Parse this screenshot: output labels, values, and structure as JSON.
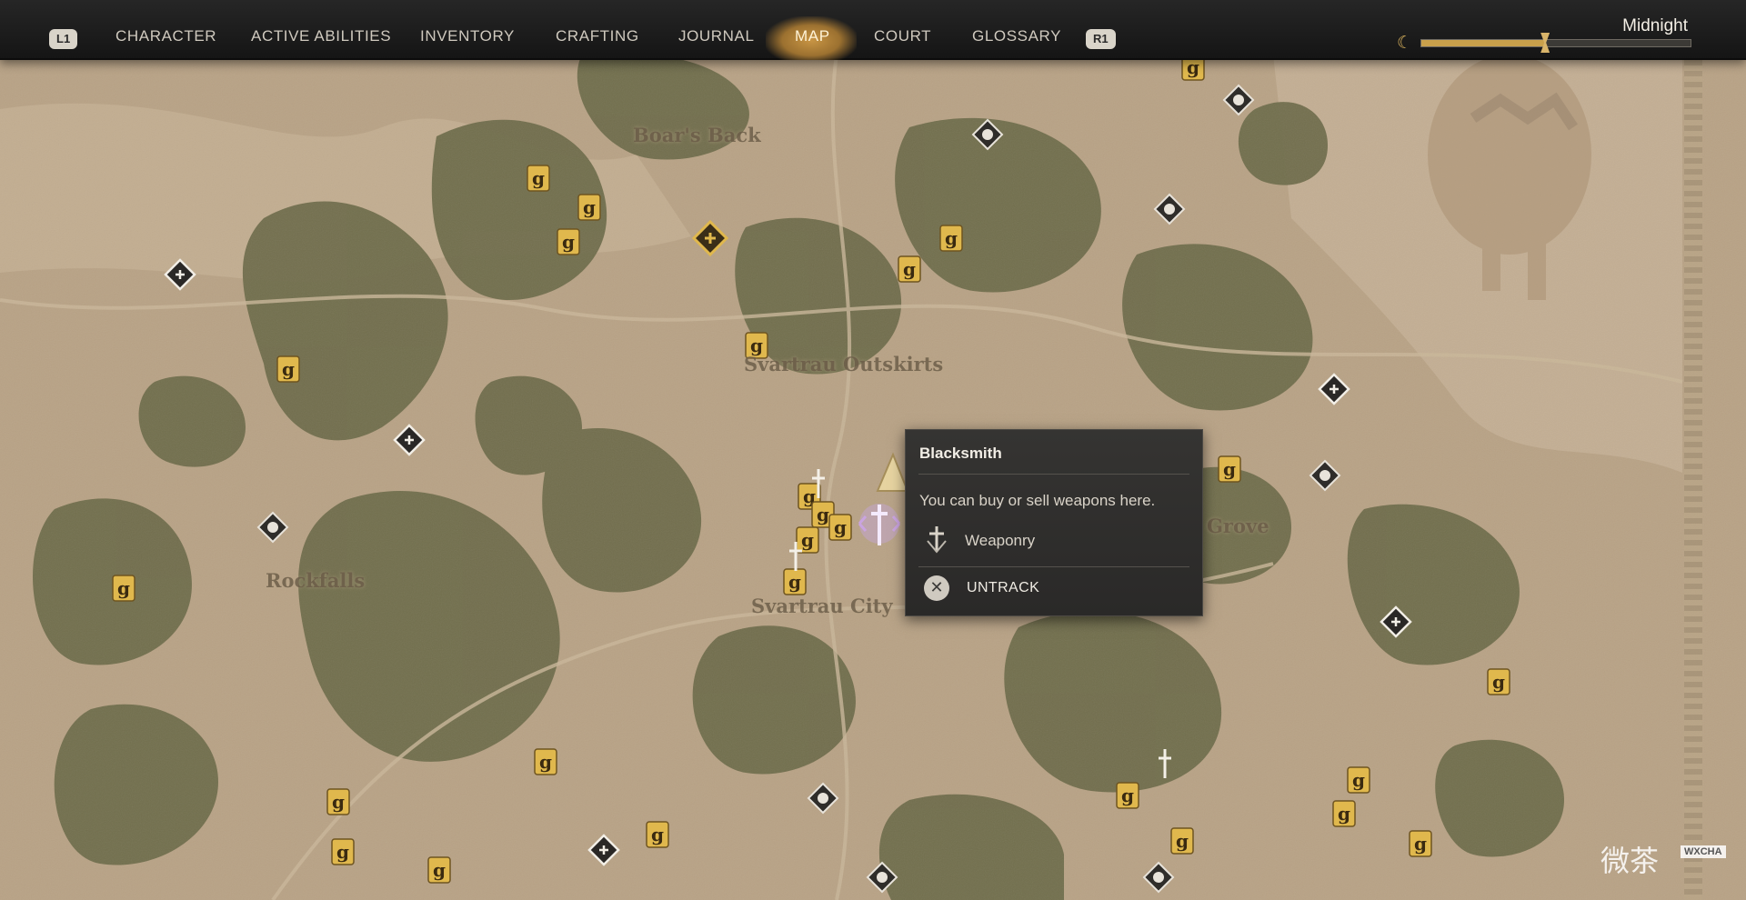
{
  "nav": {
    "left_hint": "L1",
    "right_hint": "R1",
    "tabs": [
      {
        "label": "CHARACTER",
        "active": false
      },
      {
        "label": "ACTIVE ABILITIES",
        "active": false
      },
      {
        "label": "INVENTORY",
        "active": false
      },
      {
        "label": "CRAFTING",
        "active": false
      },
      {
        "label": "JOURNAL",
        "active": false
      },
      {
        "label": "MAP",
        "active": true
      },
      {
        "label": "COURT",
        "active": false
      },
      {
        "label": "GLOSSARY",
        "active": false
      }
    ]
  },
  "time": {
    "label": "Midnight",
    "icon": "crescent-moon-icon",
    "progress": 0.46
  },
  "map": {
    "places": [
      {
        "name": "Boar's Back",
        "icon": "trident-icon"
      },
      {
        "name": "Svartrau Outskirts"
      },
      {
        "name": "Rockfalls",
        "icon": "trident-icon"
      },
      {
        "name": "Svartrau City"
      },
      {
        "name": "Grove"
      }
    ],
    "icon_legend": {
      "gold": "gold-rune-marker-icon",
      "diamond": "diamond-waypoint-icon",
      "sword": "sword-marker-icon",
      "highlight": "gold-diamond-marker-icon"
    }
  },
  "popup": {
    "title": "Blacksmith",
    "description": "You can buy or sell weapons here.",
    "category_icon": "weaponry-icon",
    "category": "Weaponry",
    "action_icon": "x-button-icon",
    "action": "UNTRACK"
  },
  "watermark": {
    "text": "微茶",
    "tag": "WXCHA"
  },
  "colors": {
    "map_sand": "#b8a285",
    "map_forest": "#6b6a48",
    "gold": "#e0b84d",
    "accent": "#c89544",
    "popup_bg": "#302f2d"
  }
}
